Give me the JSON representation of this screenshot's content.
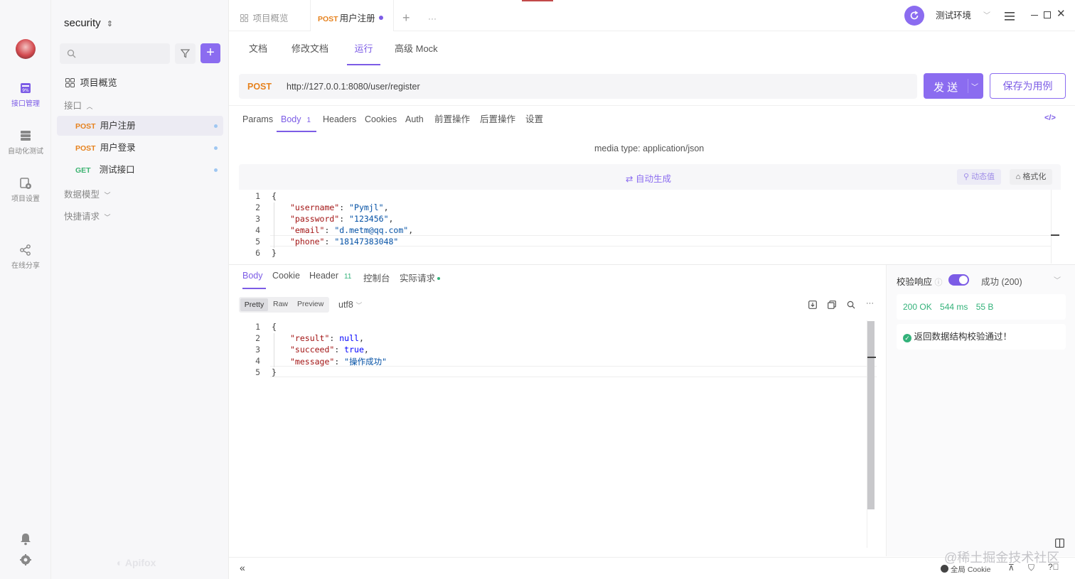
{
  "rail": {
    "items": [
      {
        "label": "接口管理"
      },
      {
        "label": "自动化测试"
      },
      {
        "label": "项目设置"
      },
      {
        "label": "在线分享"
      }
    ]
  },
  "sidebar": {
    "project_name": "security",
    "search_placeholder": "",
    "overview_label": "项目概览",
    "folder_api": "接口",
    "apis": [
      {
        "method": "POST",
        "name": "用户注册"
      },
      {
        "method": "POST",
        "name": "用户登录"
      },
      {
        "method": "GET",
        "name": "测试接口"
      }
    ],
    "folder_models": "数据模型",
    "folder_quick": "快捷请求",
    "watermark": "Apifox"
  },
  "tabs": {
    "overview": "项目概览",
    "active_method": "POST",
    "active_name": "用户注册",
    "add": "+",
    "more": "···"
  },
  "env": {
    "name": "测试环境"
  },
  "subtabs": [
    "文档",
    "修改文档",
    "运行",
    "高级 Mock"
  ],
  "request": {
    "method": "POST",
    "url": "http://127.0.0.1:8080/user/register",
    "send_label": "发 送",
    "save_label": "保存为用例"
  },
  "param_tabs": [
    {
      "label": "Params"
    },
    {
      "label": "Body",
      "count": "1"
    },
    {
      "label": "Headers"
    },
    {
      "label": "Cookies"
    },
    {
      "label": "Auth"
    },
    {
      "label": "前置操作"
    },
    {
      "label": "后置操作"
    },
    {
      "label": "设置"
    }
  ],
  "body": {
    "media_type": "media type: application/json",
    "auto_generate": "自动生成",
    "dynamic_value": "动态值",
    "format": "格式化",
    "lines": [
      {
        "n": "1",
        "text": "{"
      },
      {
        "n": "2",
        "key": "\"username\"",
        "val": "\"Pymjl\"",
        "tail": ","
      },
      {
        "n": "3",
        "key": "\"password\"",
        "val": "\"123456\"",
        "tail": ","
      },
      {
        "n": "4",
        "key": "\"email\"",
        "val": "\"d.metm@qq.com\"",
        "tail": ","
      },
      {
        "n": "5",
        "key": "\"phone\"",
        "val": "\"18147383048\"",
        "tail": ""
      },
      {
        "n": "6",
        "text": "}"
      }
    ]
  },
  "response": {
    "tabs": [
      {
        "label": "Body"
      },
      {
        "label": "Cookie"
      },
      {
        "label": "Header",
        "count": "11"
      },
      {
        "label": "控制台"
      },
      {
        "label": "实际请求"
      }
    ],
    "views": [
      "Pretty",
      "Raw",
      "Preview"
    ],
    "encoding": "utf8",
    "lines": [
      {
        "n": "1",
        "text": "{"
      },
      {
        "n": "2",
        "key": "\"result\"",
        "val": "null",
        "tail": ","
      },
      {
        "n": "3",
        "key": "\"succeed\"",
        "val": "true",
        "tail": ","
      },
      {
        "n": "4",
        "key": "\"message\"",
        "val": "\"操作成功\"",
        "tail": ""
      },
      {
        "n": "5",
        "text": "}"
      }
    ]
  },
  "validation": {
    "label": "校验响应",
    "result": "成功 (200)",
    "status": "200 OK",
    "time": "544 ms",
    "size": "55 B",
    "message": "返回数据结构校验通过！"
  },
  "footer": {
    "cookie_label": "全局 Cookie",
    "watermark": "@稀土掘金技术社区"
  },
  "colors": {
    "accent": "#7c5ce6",
    "post": "#e6821e",
    "get": "#3cb371",
    "success": "#33b27a"
  }
}
